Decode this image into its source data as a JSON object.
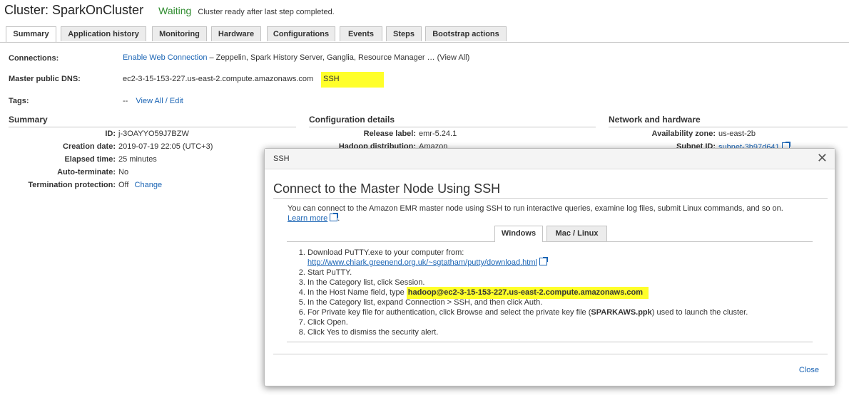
{
  "header": {
    "title": "Cluster: SparkOnCluster",
    "status": "Waiting",
    "status_message": "Cluster ready after last step completed."
  },
  "tabs": [
    "Summary",
    "Application history",
    "Monitoring",
    "Hardware",
    "Configurations",
    "Events",
    "Steps",
    "Bootstrap actions"
  ],
  "top_fields": {
    "connections_label": "Connections:",
    "connections_link": "Enable Web Connection",
    "connections_text": " – Zeppelin, Spark History Server, Ganglia, Resource Manager … (View All)",
    "dns_label": "Master public DNS:",
    "dns_value": "ec2-3-15-153-227.us-east-2.compute.amazonaws.com",
    "ssh_link": "SSH",
    "tags_label": "Tags:",
    "tags_dash": "--",
    "tags_link": "View All / Edit"
  },
  "summary": {
    "heading": "Summary",
    "rows": [
      {
        "label": "ID:",
        "value": "j-3OAYYO59J7BZW"
      },
      {
        "label": "Creation date:",
        "value": "2019-07-19 22:05 (UTC+3)"
      },
      {
        "label": "Elapsed time:",
        "value": "25 minutes"
      },
      {
        "label": "Auto-terminate:",
        "value": "No"
      },
      {
        "label": "Termination protection:",
        "value": "Off",
        "link": "Change"
      }
    ]
  },
  "config": {
    "heading": "Configuration details",
    "release_label": "Release label:",
    "release_value": "emr-5.24.1",
    "hadoop_label": "Hadoop distribution:",
    "hadoop_value": "Amazon"
  },
  "network": {
    "heading": "Network and hardware",
    "az_label": "Availability zone:",
    "az_value": "us-east-2b",
    "subnet_label": "Subnet ID:",
    "subnet_value": "subnet-3b97d641"
  },
  "modal": {
    "header_title": "SSH",
    "title": "Connect to the Master Node Using SSH",
    "intro": "You can connect to the Amazon EMR master node using SSH to run interactive queries, examine log files, submit Linux commands, and so on.",
    "learn_more": "Learn more",
    "tabs": [
      "Windows",
      "Mac / Linux"
    ],
    "steps": {
      "s1": "Download PuTTY.exe to your computer from:",
      "s1_link": "http://www.chiark.greenend.org.uk/~sgtatham/putty/download.html",
      "s2": "Start PuTTY.",
      "s3": "In the Category list, click Session.",
      "s4_prefix": "In the Host Name field, type ",
      "s4_host": "hadoop@ec2-3-15-153-227.us-east-2.compute.amazonaws.com",
      "s5": "In the Category list, expand Connection > SSH, and then click Auth.",
      "s6_prefix": "For Private key file for authentication, click Browse and select the private key file (",
      "s6_key": "SPARKAWS.ppk",
      "s6_suffix": ") used to launch the cluster.",
      "s7": "Click Open.",
      "s8": "Click Yes to dismiss the security alert."
    },
    "close": "Close"
  }
}
